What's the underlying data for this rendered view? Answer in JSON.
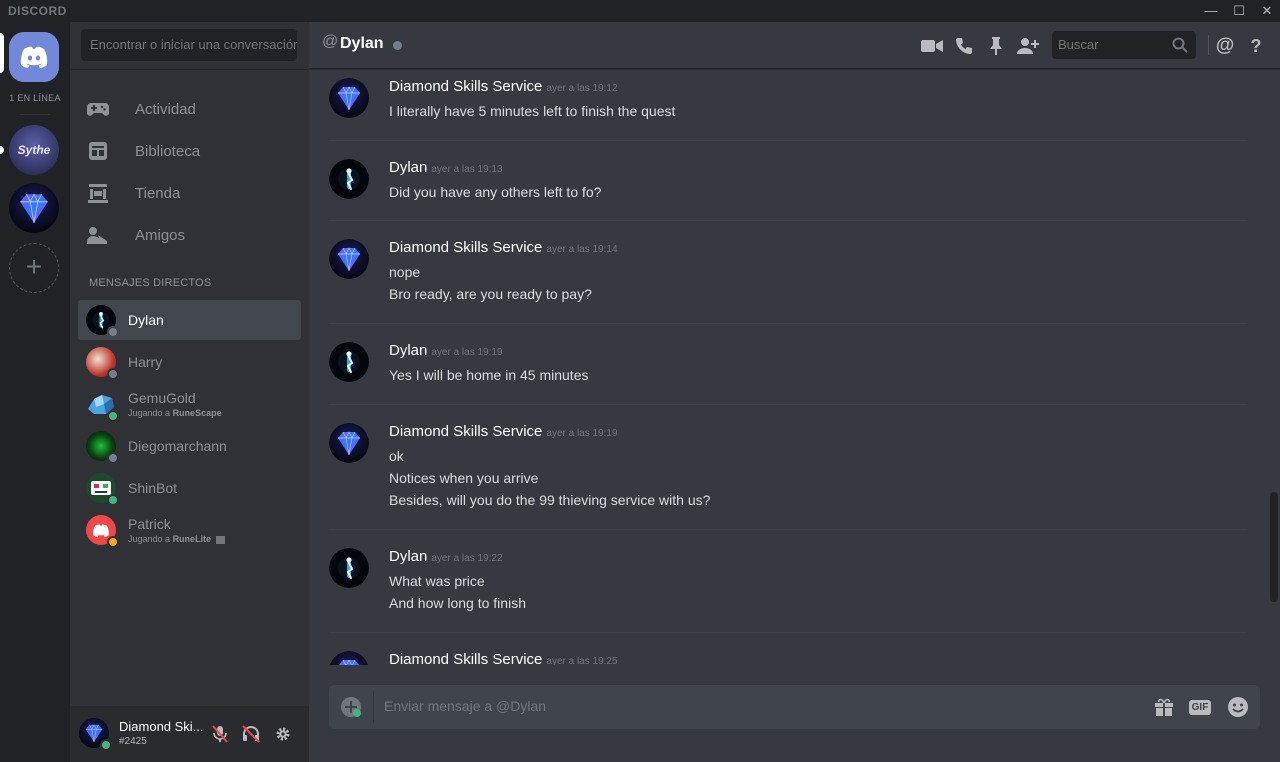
{
  "app": {
    "brand": "DISCORD",
    "accent": "#7289da"
  },
  "window": {
    "minimize": "—",
    "maximize": "☐",
    "close": "✕"
  },
  "guilds": {
    "online_count": "1 EN LÍNEA",
    "servers": [
      {
        "name": "Sythe",
        "icon_text": "Sythe"
      },
      {
        "name": "Diamond Skills Service",
        "icon": "diamond-icon"
      }
    ],
    "add_label": "+"
  },
  "sidebar": {
    "search_placeholder": "Encontrar o iniciar una conversación",
    "nav": [
      {
        "label": "Actividad",
        "icon": "gamepad-icon"
      },
      {
        "label": "Biblioteca",
        "icon": "library-icon"
      },
      {
        "label": "Tienda",
        "icon": "store-icon"
      },
      {
        "label": "Amigos",
        "icon": "friends-icon"
      }
    ],
    "dm_header": "MENSAJES DIRECTOS",
    "dms": [
      {
        "name": "Dylan",
        "status": "offline",
        "active": true
      },
      {
        "name": "Harry",
        "status": "offline"
      },
      {
        "name": "GemuGold",
        "status": "online",
        "activity_prefix": "Jugando a",
        "activity_game": "RuneScape"
      },
      {
        "name": "Diegomarchann",
        "status": "offline"
      },
      {
        "name": "ShinBot",
        "status": "online"
      },
      {
        "name": "Patrick",
        "status": "idle",
        "activity_prefix": "Jugando a",
        "activity_game": "RuneLite"
      }
    ]
  },
  "user_panel": {
    "name": "Diamond Skills Service",
    "name_display": "Diamond Ski...",
    "tag": "#2425"
  },
  "channel": {
    "at": "@",
    "name": "Dylan",
    "search_placeholder": "Buscar",
    "mention_label": "@",
    "help_label": "?"
  },
  "messages": [
    {
      "author": "Diamond Skills Service",
      "timestamp": "ayer a las 19:12",
      "lines": [
        "I literally have 5 minutes left to finish the quest"
      ]
    },
    {
      "author": "Dylan",
      "timestamp": "ayer a las 19:13",
      "lines": [
        "Did you have any others left to fo?"
      ]
    },
    {
      "author": "Diamond Skills Service",
      "timestamp": "ayer a las 19:14",
      "lines": [
        "nope",
        "Bro ready, are you ready to pay?"
      ]
    },
    {
      "author": "Dylan",
      "timestamp": "ayer a las 19:19",
      "lines": [
        "Yes I will be home in 45 minutes"
      ]
    },
    {
      "author": "Diamond Skills Service",
      "timestamp": "ayer a las 19:19",
      "lines": [
        "ok",
        "Notices when you arrive",
        "Besides, will you do the 99 thieving service with us?"
      ]
    },
    {
      "author": "Dylan",
      "timestamp": "ayer a las 19:22",
      "lines": [
        "What was price",
        "And how long to finish"
      ]
    },
    {
      "author": "Diamond Skills Service",
      "timestamp": "ayer a las 19:25",
      "lines": []
    }
  ],
  "composer": {
    "placeholder": "Enviar mensaje a @Dylan",
    "gif_label": "GIF"
  },
  "colors": {
    "online": "#43b581",
    "idle": "#faa61a",
    "offline": "#747f8d",
    "background": "#36393f",
    "sidebar": "#2f3136"
  }
}
